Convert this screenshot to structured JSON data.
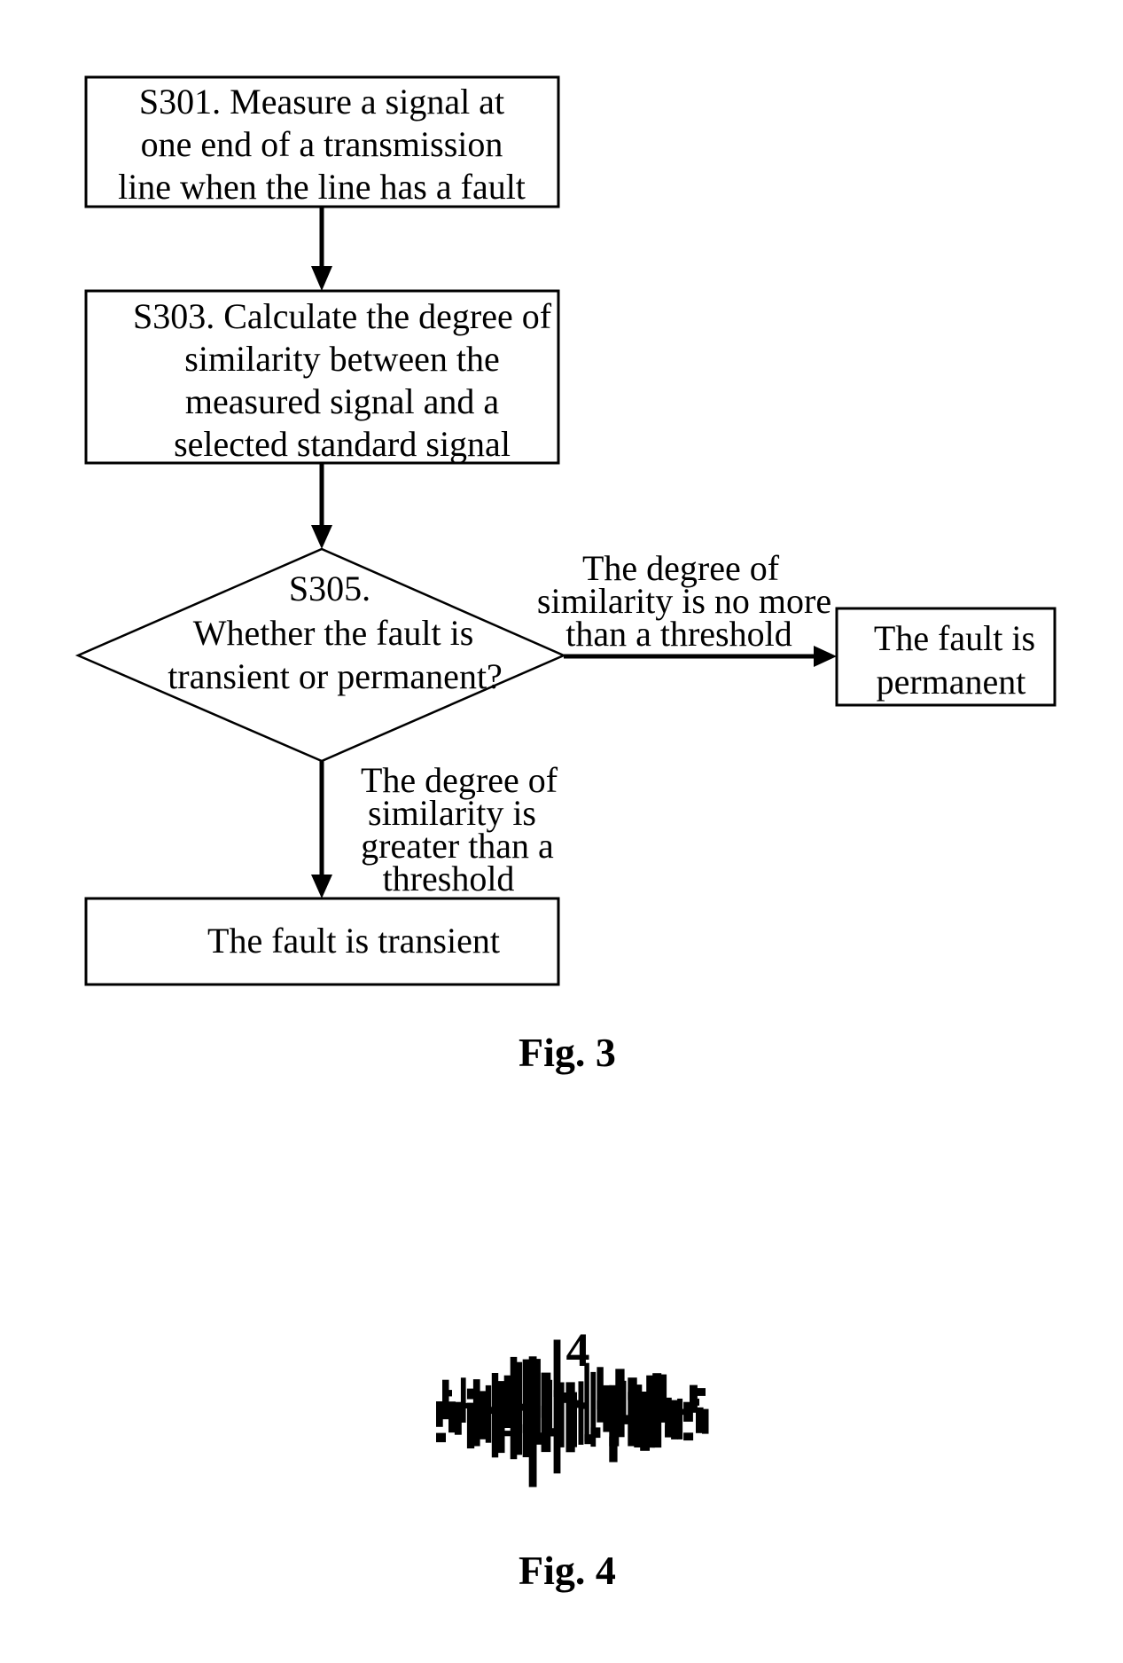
{
  "figures": {
    "fig3": {
      "caption": "Fig. 3",
      "nodes": {
        "s301": {
          "lines": [
            "S301. Measure a signal at",
            "one end of a transmission",
            "line when the line has a fault"
          ]
        },
        "s303": {
          "lines": [
            "S303. Calculate the degree of",
            "similarity between the",
            "measured signal and a",
            "selected standard signal"
          ]
        },
        "s305": {
          "lines": [
            "S305.",
            "Whether the fault is",
            "transient or permanent?"
          ]
        },
        "permanent": {
          "lines": [
            "The fault is",
            "permanent"
          ]
        },
        "transient": {
          "lines": [
            "The fault is transient"
          ]
        }
      },
      "edges": {
        "to_permanent": {
          "lines": [
            "The degree of",
            "similarity is no more",
            "than a threshold"
          ]
        },
        "to_transient": {
          "lines": [
            "The degree of",
            "similarity is",
            "greater than a",
            "threshold"
          ]
        }
      }
    },
    "fig4": {
      "caption": "Fig. 4",
      "label": "4",
      "waveform_icon": "noisy-signal-waveform"
    }
  }
}
